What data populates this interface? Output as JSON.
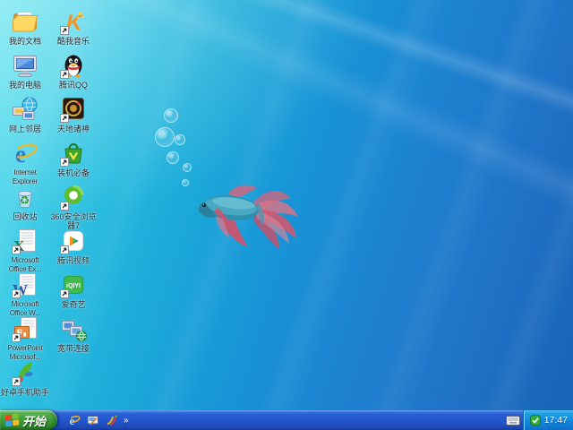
{
  "desktop": {
    "icons": [
      {
        "name": "my-documents",
        "label": "我的文档"
      },
      {
        "name": "kuwo-music",
        "label": "酷我音乐"
      },
      {
        "name": "my-computer",
        "label": "我的电脑"
      },
      {
        "name": "tencent-qq",
        "label": "腾讯QQ"
      },
      {
        "name": "network-places",
        "label": "网上邻居"
      },
      {
        "name": "tiandizhushen-game",
        "label": "天地诸神"
      },
      {
        "name": "internet-explorer",
        "label": "Internet\nExplorer"
      },
      {
        "name": "zhuangji-bibei",
        "label": "装机必备"
      },
      {
        "name": "recycle-bin",
        "label": "回收站"
      },
      {
        "name": "360-safe-browser-7",
        "label": "360安全浏览\n器7"
      },
      {
        "name": "ms-office-excel",
        "label": "Microsoft\nOffice Ex..."
      },
      {
        "name": "tencent-video",
        "label": "腾讯视频"
      },
      {
        "name": "ms-office-word",
        "label": "Microsoft\nOffice W..."
      },
      {
        "name": "iqiyi",
        "label": "爱奇艺"
      },
      {
        "name": "ms-powerpoint",
        "label": "PowerPoint\nMicrosof..."
      },
      {
        "name": "broadband-connection",
        "label": "宽带连接"
      },
      {
        "name": "haozhuo-phone-assistant",
        "label": "好卓手机助手"
      }
    ]
  },
  "taskbar": {
    "start_label": "开始",
    "quick_launch": [
      "internet-explorer",
      "show-desktop",
      "media-player"
    ],
    "overflow_label": "»",
    "clock": "17:47"
  },
  "colors": {
    "wallpaper_cyan": "#2fd4e8",
    "wallpaper_blue": "#1763b4",
    "taskbar_blue": "#2457cd",
    "start_green": "#3f9e3a",
    "tray_blue": "#1286dc"
  }
}
